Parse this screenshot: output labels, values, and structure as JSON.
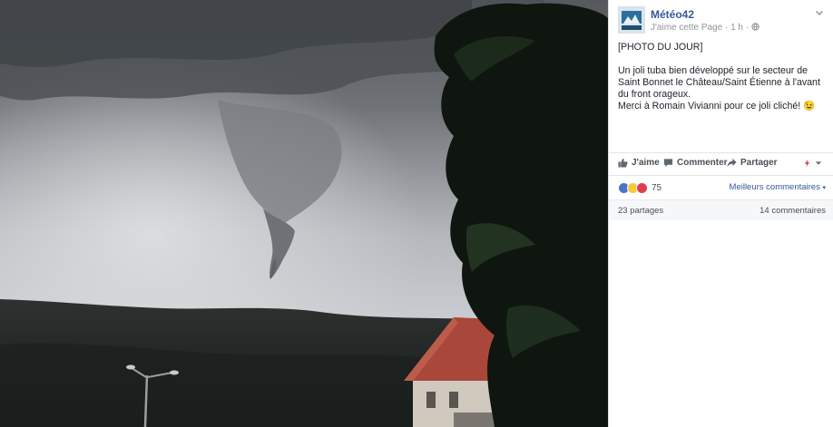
{
  "post": {
    "page_name": "Météo42",
    "like_page": "J'aime cette Page",
    "time": "1 h",
    "text_lines": [
      "[PHOTO DU JOUR]",
      "",
      "Un joli tuba bien développé sur le secteur de Saint Bonnet le Château/Saint Étienne à l'avant du front orageux.",
      "Merci à Romain Vivianni pour ce joli cliché! 😉"
    ]
  },
  "actions": {
    "like": "J'aime",
    "comment": "Commenter",
    "share": "Partager"
  },
  "reactions": {
    "count": "75",
    "best_comments": "Meilleurs commentaires"
  },
  "stats": {
    "shares": "23 partages",
    "comments": "14 commentaires"
  },
  "colors": {
    "link": "#365899",
    "like_blue": "#4a76c8",
    "love_red": "#e23d4f",
    "wow_yellow": "#f7c836"
  },
  "icons": [
    "globe-icon",
    "chevron-down-icon",
    "like-icon",
    "comment-icon",
    "share-icon",
    "flash-icon"
  ]
}
